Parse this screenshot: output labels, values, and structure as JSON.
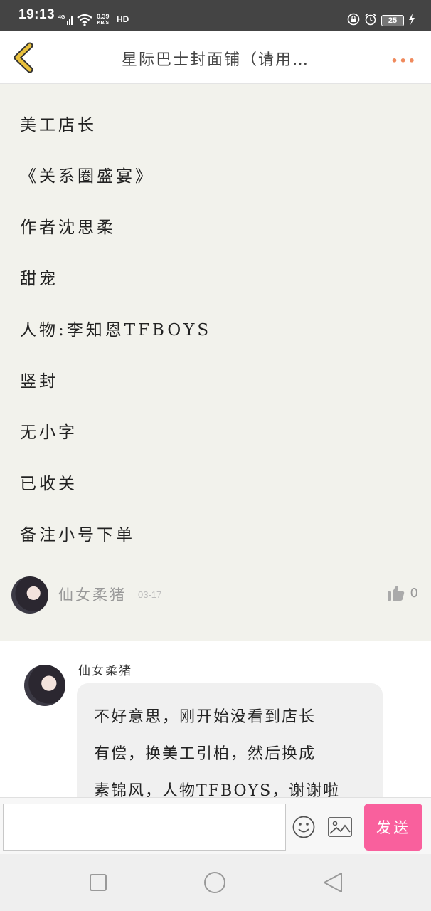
{
  "status_bar": {
    "time": "19:13",
    "network": "4G",
    "speed_value": "0.39",
    "speed_unit": "KB/S",
    "hd": "HD",
    "battery": "25"
  },
  "header": {
    "title": "星际巴士封面铺（请用…",
    "more_label": "•••"
  },
  "post": {
    "lines": [
      "美工店长",
      "《关系圈盛宴》",
      "作者沈思柔",
      "甜宠",
      "人物:李知恩TFBOYS",
      "竖封",
      "无小字",
      "已收关",
      "备注小号下单"
    ],
    "author": "仙女柔猪",
    "date": "03-17",
    "likes": "0"
  },
  "reply": {
    "author": "仙女柔猪",
    "lines": [
      "不好意思，刚开始没看到店长",
      "有偿，换美工引柏，然后换成",
      "素锦风，人物TFBOYS，谢谢啦"
    ]
  },
  "input_bar": {
    "placeholder": "",
    "send_label": "发送"
  },
  "colors": {
    "accent_send": "#f9609d",
    "more_dots": "#f08a5d",
    "back_arrow": "#e8c03c"
  }
}
